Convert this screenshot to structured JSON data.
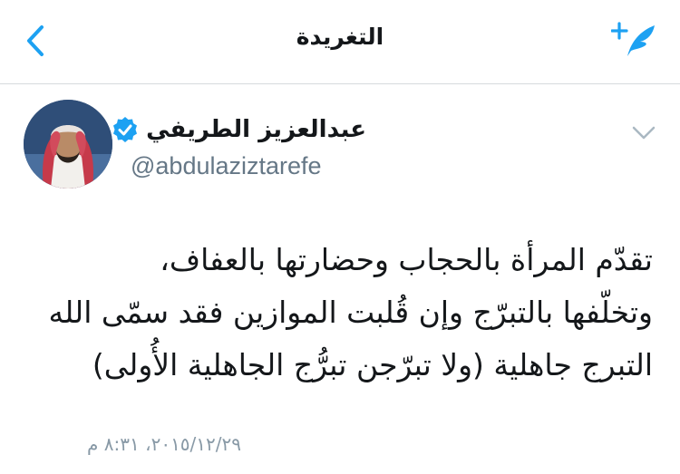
{
  "nav": {
    "title": "التغريدة",
    "back_icon": "chevron-left-icon",
    "compose_icon": "compose-tweet-icon",
    "accent": "#1da1f2"
  },
  "author": {
    "display_name": "عبدالعزيز الطريفي",
    "handle": "@abdulaziztarefe",
    "verified": true,
    "verified_color": "#1da1f2"
  },
  "tweet": {
    "text": "تقدّم المرأة بالحجاب وحضارتها بالعفاف،\nوتخلّفها بالتبرّج وإن قُلبت الموازين فقد سمّى الله\nالتبرج جاهلية (ولا تبرّجن تبرُّج الجاهلية الأُولى)",
    "timestamp": "٢٠١٥/١٢/٢٩، ٨:٣١ م"
  }
}
